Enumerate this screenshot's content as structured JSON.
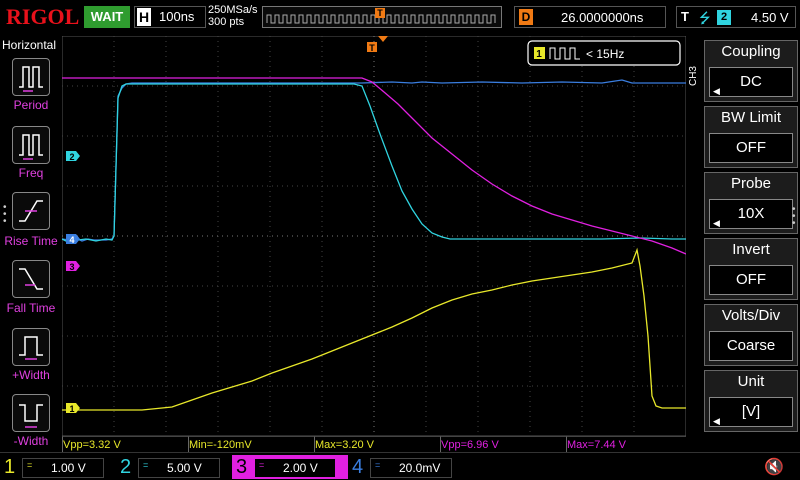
{
  "header": {
    "logo": "RIGOL",
    "run_status": "WAIT",
    "timebase_label": "H",
    "timebase": "100ns",
    "sample_rate": "250MSa/s",
    "memory_depth": "300 pts",
    "memory_trigger_marker": "T",
    "delay_label": "D",
    "delay": "26.0000000ns",
    "trigger_label": "T",
    "trigger_source": "2",
    "trigger_level": "4.50 V",
    "colors": {
      "run_status": "#2f9c2f",
      "delay": "#f07a14",
      "trigger": "#30d4e0"
    }
  },
  "left_menu": {
    "title": "Horizontal",
    "items": [
      {
        "label": "Period",
        "icon": "period-icon"
      },
      {
        "label": "Freq",
        "icon": "frequency-icon"
      },
      {
        "label": "Rise Time",
        "icon": "rise-time-icon"
      },
      {
        "label": "Fall Time",
        "icon": "fall-time-icon"
      },
      {
        "label": "+Width",
        "icon": "positive-width-icon"
      },
      {
        "label": "-Width",
        "icon": "negative-width-icon"
      }
    ]
  },
  "display": {
    "trigger_marker": "T",
    "counter": {
      "channel": "1",
      "value": "< 15Hz"
    },
    "channel_markers": [
      {
        "ch": "2",
        "color": "#30d4e0"
      },
      {
        "ch": "4",
        "color": "#3a7ee0"
      },
      {
        "ch": "3",
        "color": "#e020e0"
      },
      {
        "ch": "1",
        "color": "#e8e82a"
      }
    ]
  },
  "measurements": [
    {
      "text": "Vpp=3.32 V",
      "color": "#e8e82a"
    },
    {
      "text": "Min=-120mV",
      "color": "#e8e82a"
    },
    {
      "text": "Max=3.20 V",
      "color": "#e8e82a"
    },
    {
      "text": "Vpp=6.96 V",
      "color": "#e020e0"
    },
    {
      "text": "Max=7.44 V",
      "color": "#e020e0"
    }
  ],
  "right_menu": {
    "channel_tag": "CH3",
    "items": [
      {
        "title": "Coupling",
        "value": "DC",
        "arrow": true
      },
      {
        "title": "BW Limit",
        "value": "OFF",
        "arrow": false
      },
      {
        "title": "Probe",
        "value": "10X",
        "arrow": true
      },
      {
        "title": "Invert",
        "value": "OFF",
        "arrow": false
      },
      {
        "title": "Volts/Div",
        "value": "Coarse",
        "arrow": false
      },
      {
        "title": "Unit",
        "value": "[V]",
        "arrow": true
      }
    ]
  },
  "channels": [
    {
      "num": "1",
      "coupling": "=",
      "scale": "1.00 V",
      "color": "#e8e82a"
    },
    {
      "num": "2",
      "coupling": "=",
      "scale": "5.00 V",
      "color": "#30d4e0"
    },
    {
      "num": "3",
      "coupling": "=",
      "scale": "2.00 V",
      "color": "#e020e0"
    },
    {
      "num": "4",
      "coupling": "=",
      "scale": "20.0mV",
      "color": "#3a7ee0"
    }
  ]
}
